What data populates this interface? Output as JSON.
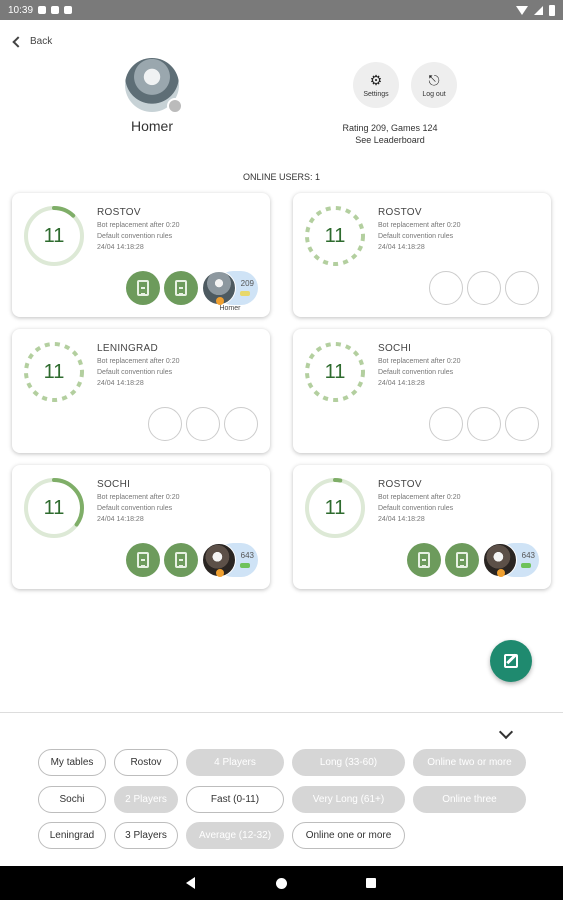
{
  "status_bar": {
    "time": "10:39"
  },
  "header": {
    "back_label": "Back",
    "user_name": "Homer",
    "settings_label": "Settings",
    "logout_label": "Log out",
    "rating_text": "Rating 209, Games 124",
    "leaderboard_link": "See Leaderboard"
  },
  "online_users": "ONLINE USERS: 1",
  "tables": [
    {
      "count": "11",
      "city": "ROSTOV",
      "bot": "Bot replacement after 0:20",
      "rules": "Default convention rules",
      "date": "24/04 14:18:28",
      "progress": 0.12,
      "dashed": false,
      "seats": [
        {
          "kind": "bot"
        },
        {
          "kind": "bot"
        },
        {
          "kind": "user",
          "score": "209",
          "name": "Homer"
        }
      ]
    },
    {
      "count": "11",
      "city": "ROSTOV",
      "bot": "Bot replacement after 0:20",
      "rules": "Default convention rules",
      "date": "24/04 14:18:28",
      "progress": 0,
      "dashed": true,
      "seats": [
        {
          "kind": "empty"
        },
        {
          "kind": "empty"
        },
        {
          "kind": "empty"
        }
      ]
    },
    {
      "count": "11",
      "city": "LENINGRAD",
      "bot": "Bot replacement after 0:20",
      "rules": "Default convention rules",
      "date": "24/04 14:18:28",
      "progress": 0,
      "dashed": true,
      "seats": [
        {
          "kind": "empty"
        },
        {
          "kind": "empty"
        },
        {
          "kind": "empty"
        }
      ]
    },
    {
      "count": "11",
      "city": "SOCHI",
      "bot": "Bot replacement after 0:20",
      "rules": "Default convention rules",
      "date": "24/04 14:18:28",
      "progress": 0,
      "dashed": true,
      "seats": [
        {
          "kind": "empty"
        },
        {
          "kind": "empty"
        },
        {
          "kind": "empty"
        }
      ]
    },
    {
      "count": "11",
      "city": "SOCHI",
      "bot": "Bot replacement after 0:20",
      "rules": "Default convention rules",
      "date": "24/04 14:18:28",
      "progress": 0.35,
      "dashed": false,
      "seats": [
        {
          "kind": "bot"
        },
        {
          "kind": "bot"
        },
        {
          "kind": "user",
          "score": "643",
          "name": ""
        }
      ]
    },
    {
      "count": "11",
      "city": "ROSTOV",
      "bot": "Bot replacement after 0:20",
      "rules": "Default convention rules",
      "date": "24/04 14:18:28",
      "progress": 0.03,
      "dashed": false,
      "seats": [
        {
          "kind": "bot"
        },
        {
          "kind": "bot"
        },
        {
          "kind": "user",
          "score": "643",
          "name": ""
        }
      ]
    }
  ],
  "filters": [
    {
      "label": "My tables",
      "active": true
    },
    {
      "label": "Rostov",
      "active": true
    },
    {
      "label": "4 Players",
      "active": false
    },
    {
      "label": "Long (33-60)",
      "active": false
    },
    {
      "label": "Online two or more",
      "active": false
    },
    {
      "label": "Sochi",
      "active": true
    },
    {
      "label": "2 Players",
      "active": false
    },
    {
      "label": "Fast (0-11)",
      "active": true
    },
    {
      "label": "Very Long (61+)",
      "active": false
    },
    {
      "label": "Online three",
      "active": false
    },
    {
      "label": "Leningrad",
      "active": true
    },
    {
      "label": "3 Players",
      "active": true
    },
    {
      "label": "Average (12-32)",
      "active": false
    },
    {
      "label": "Online one or more",
      "active": true
    }
  ],
  "colors": {
    "ring_track": "#dde9d6",
    "ring_fill": "#7fae68",
    "dash": "#b3cf9f",
    "bot_seat": "#6d9b5c",
    "fab": "#1f8a6f"
  },
  "icons": {
    "settings": "gear-icon",
    "logout": "logout-icon",
    "fab": "edit-icon",
    "collapse": "chevron-down-icon",
    "back": "chevron-left-icon"
  }
}
